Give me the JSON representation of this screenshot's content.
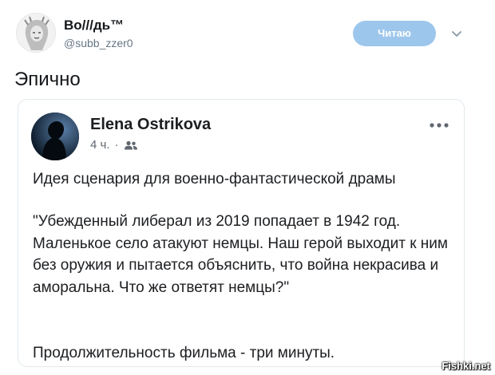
{
  "tweet": {
    "author_name": "Во///дь™",
    "author_handle": "@subb_zzer0",
    "follow_label": "Читаю",
    "text": "Эпично"
  },
  "quoted_post": {
    "author_name": "Elena Ostrikova",
    "time": "4 ч.",
    "separator": "·",
    "audience_icon": "friends-icon",
    "paragraph_1": "Идея сценария для военно-фантастической драмы",
    "paragraph_2": "\"Убежденный либерал из 2019 попадает в 1942 год. Маленькое село атакуют немцы. Наш герой выходит к ним без оружия и пытается объяснить, что война некрасива и аморальна. Что же ответят немцы?\"",
    "paragraph_3": "Продолжительность фильма - три минуты."
  },
  "watermark": "Fishki.net",
  "colors": {
    "follow_button": "#9dc6ec",
    "handle_text": "#657786",
    "card_border": "#e1e8ed"
  }
}
